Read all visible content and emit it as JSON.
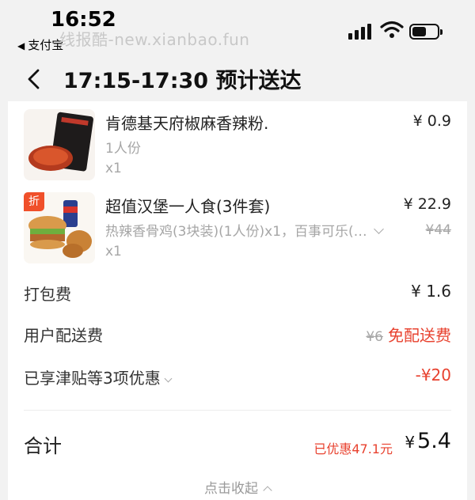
{
  "status_bar": {
    "time": "16:52",
    "back_app": "支付宝",
    "watermark": "线报酷-new.xianbao.fun"
  },
  "nav": {
    "title": "17:15-17:30 预计送达"
  },
  "items": [
    {
      "name": "肯德基天府椒麻香辣粉.",
      "spec": "1人份",
      "qty": "x1",
      "price": "¥ 0.9"
    },
    {
      "badge": "折",
      "name": "超值汉堡一人食(3件套)",
      "spec": "热辣香骨鸡(3块装)(1人份)x1，百事可乐(…",
      "qty": "x1",
      "price": "¥ 22.9",
      "original_price": "¥44"
    }
  ],
  "fees": {
    "packaging_label": "打包费",
    "packaging_value": "¥ 1.6",
    "delivery_label": "用户配送费",
    "delivery_original": "¥6",
    "delivery_value": "免配送费",
    "discount_label": "已享津贴等3项优惠",
    "discount_value": "-¥20"
  },
  "summary": {
    "total_label": "合计",
    "saved": "已优惠47.1元",
    "yen": "¥",
    "total_value": "5.4",
    "collapse_label": "点击收起"
  },
  "colors": {
    "accent_red": "#e8422f",
    "badge_orange": "#f0502a"
  }
}
